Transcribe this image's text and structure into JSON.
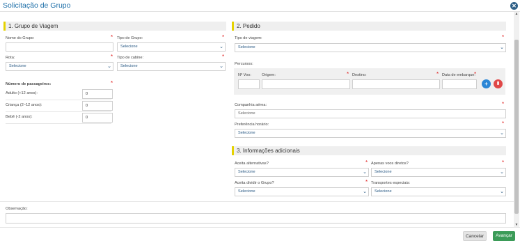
{
  "modal": {
    "title": "Solicitação de Grupo",
    "close_icon": "close-icon"
  },
  "section1": {
    "title": "1. Grupo de Viagem",
    "nome_grupo": {
      "label": "Nome do Grupo:",
      "value": ""
    },
    "tipo_grupo": {
      "label": "Tipo de Grupo:",
      "value": "Selecione"
    },
    "rota": {
      "label": "Rota:",
      "value": "Selecione"
    },
    "tipo_cabine": {
      "label": "Tipo de cabine:",
      "value": "Selecione"
    },
    "passageiros": {
      "label": "Número de passageiros:",
      "rows": [
        {
          "label": "Adulto (+12 anos):",
          "value": "0"
        },
        {
          "label": "Criança (2~12 anos):",
          "value": "0"
        },
        {
          "label": "Bebê (-2 anos):",
          "value": "0"
        }
      ]
    }
  },
  "section2": {
    "title": "2. Pedido",
    "tipo_viagem": {
      "label": "Tipo de viagem:",
      "value": "Selecione"
    },
    "percursos": {
      "label": "Percursos:",
      "columns": [
        "Nº Voo:",
        "Origem:",
        "Destino:",
        "Data de embarque:"
      ]
    },
    "companhia": {
      "label": "Companhia aérea:",
      "placeholder": "Selecione"
    },
    "horario": {
      "label": "Preferência horário:",
      "value": "Selecione"
    }
  },
  "section3": {
    "title": "3. Informações adicionais",
    "aceita_alternativas": {
      "label": "Aceita alternativas?",
      "value": "Selecione"
    },
    "voos_diretos": {
      "label": "Apenas voos diretos?",
      "value": "Selecione"
    },
    "dividir_grupo": {
      "label": "Aceita dividir o Grupo?",
      "value": "Selecione"
    },
    "transportes": {
      "label": "Transportes especiais:",
      "value": "Selecione"
    }
  },
  "observacao": {
    "label": "Observação:",
    "value": ""
  },
  "footer": {
    "cancel_label": "Cancelar",
    "next_label": "Avançar"
  },
  "colors": {
    "accent_yellow": "#e5d200",
    "title_blue": "#1e6fa8",
    "success_green": "#3b9b58",
    "danger_red": "#e04848",
    "add_blue": "#2b86d6"
  }
}
